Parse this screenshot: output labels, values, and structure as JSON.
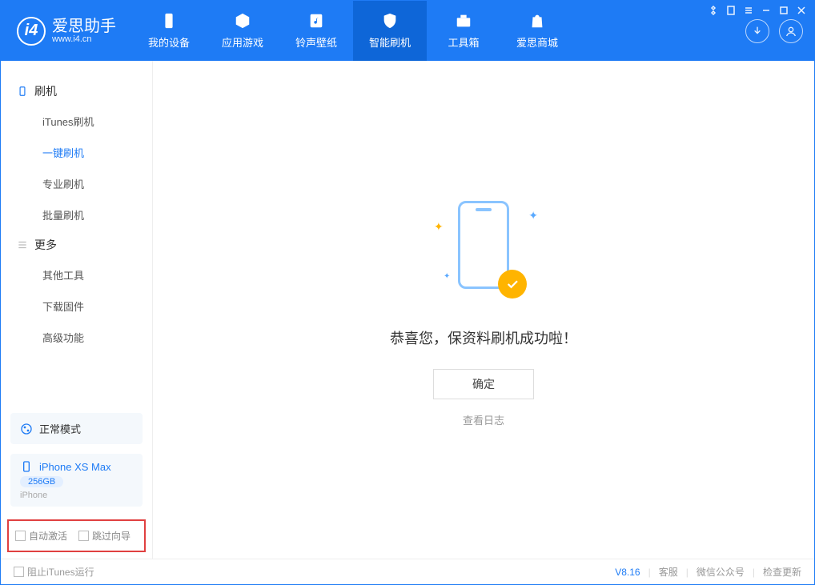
{
  "app": {
    "name": "爱思助手",
    "url": "www.i4.cn"
  },
  "nav": {
    "mydevice": "我的设备",
    "apps": "应用游戏",
    "ringtones": "铃声壁纸",
    "smartflash": "智能刷机",
    "toolbox": "工具箱",
    "store": "爱思商城"
  },
  "sidebar": {
    "group_flash": "刷机",
    "itunes_flash": "iTunes刷机",
    "oneclick_flash": "一键刷机",
    "pro_flash": "专业刷机",
    "batch_flash": "批量刷机",
    "group_more": "更多",
    "other_tools": "其他工具",
    "download_fw": "下载固件",
    "advanced": "高级功能",
    "normal_mode": "正常模式",
    "device_name": "iPhone XS Max",
    "device_capacity": "256GB",
    "device_type": "iPhone",
    "auto_activate": "自动激活",
    "skip_guide": "跳过向导"
  },
  "main": {
    "success": "恭喜您，保资料刷机成功啦！",
    "ok": "确定",
    "view_log": "查看日志"
  },
  "footer": {
    "block_itunes": "阻止iTunes运行",
    "version": "V8.16",
    "support": "客服",
    "wechat": "微信公众号",
    "check_update": "检查更新"
  }
}
